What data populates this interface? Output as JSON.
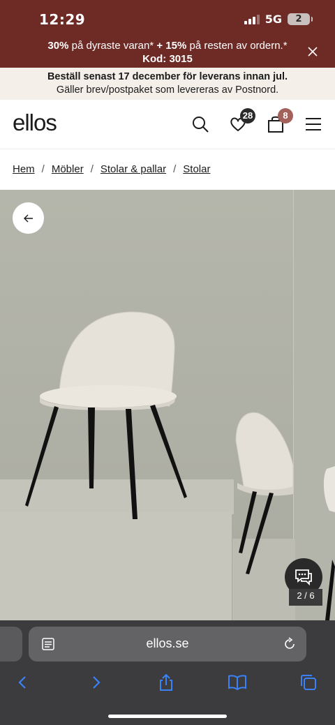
{
  "status": {
    "time": "12:29",
    "network": "5G",
    "battery": "2"
  },
  "promo": {
    "pct1": "30%",
    "text1": " på dyraste varan* ",
    "plus": "+ 15%",
    "text2": " på resten av ordern.*",
    "code": "Kod: 3015"
  },
  "notice": {
    "line1": "Beställ senast 17 december för leverans innan jul.",
    "line2": "Gäller brev/postpaket som levereras av Postnord."
  },
  "header": {
    "logo": "ellos",
    "wishlist_count": "28",
    "cart_count": "8"
  },
  "breadcrumb": {
    "items": [
      "Hem",
      "Möbler",
      "Stolar & pallar",
      "Stolar"
    ],
    "separator": "/"
  },
  "gallery": {
    "counter": "2 / 6"
  },
  "browser": {
    "url": "ellos.se"
  },
  "colors": {
    "promo_bg": "#6e2a25",
    "notice_bg": "#f4efe8",
    "wishlist_badge": "#2a2a2a",
    "cart_badge": "#a4605a",
    "safari_bg": "#3c3c3e",
    "safari_accent": "#3b82f6"
  }
}
